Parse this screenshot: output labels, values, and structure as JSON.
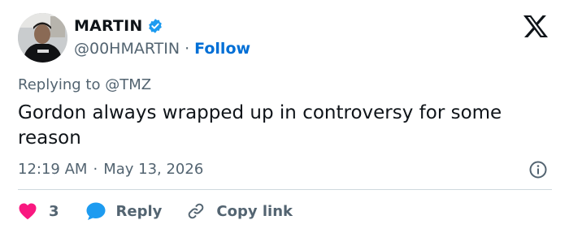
{
  "author": {
    "name": "MARTIN",
    "handle": "@00HMARTIN",
    "separator": "·",
    "follow_label": "Follow"
  },
  "reply_context": {
    "prefix": "Replying to",
    "target": "@TMZ"
  },
  "tweet": {
    "text": "Gordon always wrapped up in controversy for some reason"
  },
  "meta": {
    "time": "12:19 AM",
    "separator": "·",
    "date": "May 13, 2026"
  },
  "actions": {
    "like_count": "3",
    "reply_label": "Reply",
    "copy_label": "Copy link"
  },
  "icons": {
    "verified": "verified-badge-icon",
    "logo": "x-logo-icon",
    "info": "info-icon",
    "like": "heart-icon",
    "reply": "speech-bubble-icon",
    "copy": "link-icon"
  },
  "colors": {
    "accent": "#1d9bf0",
    "follow": "#006fd6",
    "like": "#f91880",
    "muted": "#536471",
    "text": "#0f1419"
  }
}
